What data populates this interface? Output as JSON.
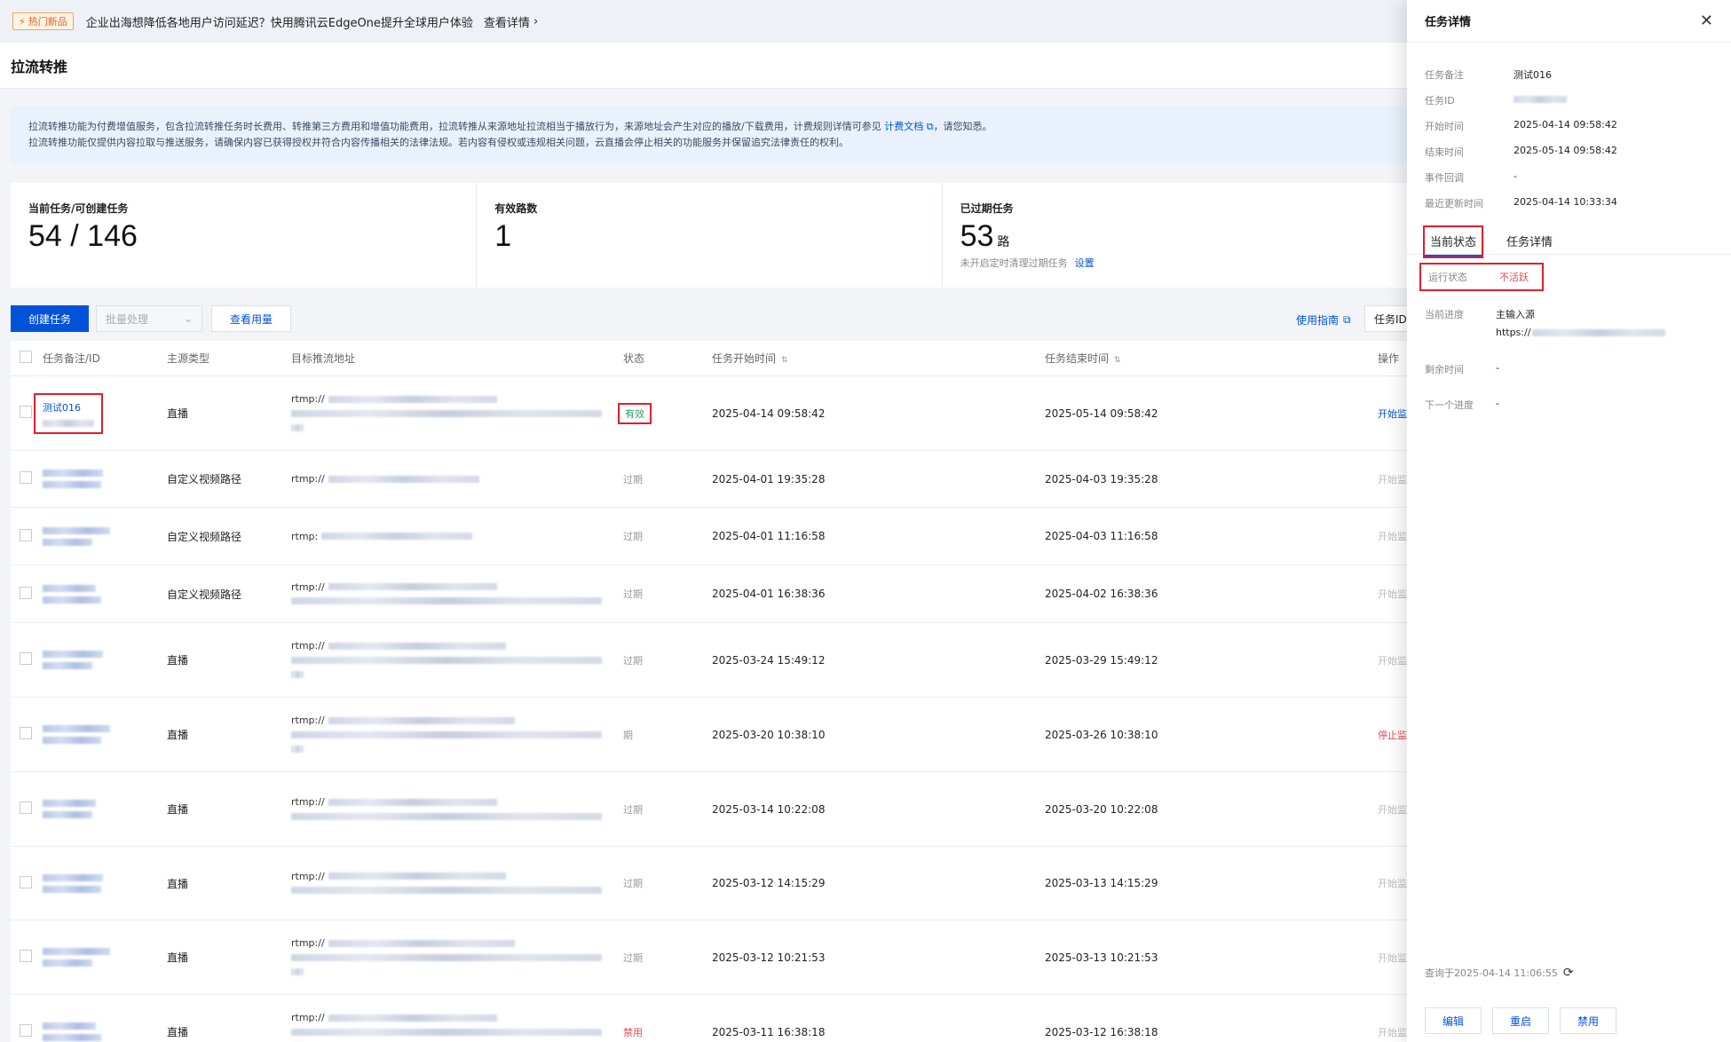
{
  "banner": {
    "tag": "热门新品",
    "text": "企业出海想降低各地用户访问延迟？快用腾讯云EdgeOne提升全球用户体验",
    "link": "查看详情"
  },
  "page": {
    "title": "拉流转推"
  },
  "notice": {
    "line1_pre": "拉流转推功能为付费增值服务，包含拉流转推任务时长费用、转推第三方费用和增值功能费用，拉流转推从来源地址拉流相当于播放行为，来源地址会产生对应的播放/下载费用，计费规则详情可参见",
    "line1_link": "计费文档",
    "line1_post": "，请您知悉。",
    "line2": "拉流转推功能仅提供内容拉取与推送服务，请确保内容已获得授权并符合内容传播相关的法律法规。若内容有侵权或违规相关问题，云直播会停止相关的功能服务并保留追究法律责任的权利。"
  },
  "stats": {
    "tasks_label": "当前任务/可创建任务",
    "tasks_value": "54 / 146",
    "active_label": "有效路数",
    "active_value": "1",
    "expired_label": "已过期任务",
    "expired_value": "53",
    "expired_unit": "路",
    "expired_sub": "未开启定时清理过期任务",
    "expired_link": "设置"
  },
  "toolbar": {
    "create": "创建任务",
    "batch": "批量处理",
    "usage": "查看用量",
    "guide": "使用指南",
    "search_prefix": "任务ID"
  },
  "table": {
    "headers": {
      "name": "任务备注/ID",
      "type": "主源类型",
      "addr": "目标推流地址",
      "status": "状态",
      "start": "任务开始时间",
      "end": "任务结束时间",
      "op": "操作"
    },
    "rows": [
      {
        "name": "测试016",
        "type": "直播",
        "addr": "rtmp://",
        "status": "有效",
        "start": "2025-04-14 09:58:42",
        "end": "2025-05-14 09:58:42",
        "op": "开始监"
      },
      {
        "name": "",
        "type": "自定义视频路径",
        "addr": "rtmp://",
        "status": "过期",
        "start": "2025-04-01 19:35:28",
        "end": "2025-04-03 19:35:28",
        "op": "开始监"
      },
      {
        "name": "",
        "type": "自定义视频路径",
        "addr": "rtmp:",
        "status": "过期",
        "start": "2025-04-01 11:16:58",
        "end": "2025-04-03 11:16:58",
        "op": "开始监"
      },
      {
        "name": "",
        "type": "自定义视频路径",
        "addr": "rtmp://",
        "status": "过期",
        "start": "2025-04-01 16:38:36",
        "end": "2025-04-02 16:38:36",
        "op": "开始监"
      },
      {
        "name": "",
        "type": "直播",
        "addr": "rtmp://",
        "status": "过期",
        "start": "2025-03-24 15:49:12",
        "end": "2025-03-29 15:49:12",
        "op": "开始监"
      },
      {
        "name": "",
        "type": "直播",
        "addr": "rtmp://",
        "status": "期",
        "start": "2025-03-20 10:38:10",
        "end": "2025-03-26 10:38:10",
        "op": "停止监"
      },
      {
        "name": "",
        "type": "直播",
        "addr": "rtmp://",
        "status": "过期",
        "start": "2025-03-14 10:22:08",
        "end": "2025-03-20 10:22:08",
        "op": "开始监"
      },
      {
        "name": "",
        "type": "直播",
        "addr": "rtmp://",
        "status": "过期",
        "start": "2025-03-12 14:15:29",
        "end": "2025-03-13 14:15:29",
        "op": "开始监"
      },
      {
        "name": "",
        "type": "直播",
        "addr": "rtmp://",
        "status": "过期",
        "start": "2025-03-12 10:21:53",
        "end": "2025-03-13 10:21:53",
        "op": "开始监"
      },
      {
        "name": "",
        "type": "直播",
        "addr": "rtmp://",
        "status": "禁用",
        "start": "2025-03-11 16:38:18",
        "end": "2025-03-12 16:38:18",
        "op": "开始监"
      }
    ]
  },
  "drawer": {
    "title": "任务详情",
    "remark_k": "任务备注",
    "remark_v": "测试016",
    "id_k": "任务ID",
    "start_k": "开始时间",
    "start_v": "2025-04-14 09:58:42",
    "end_k": "结束时间",
    "end_v": "2025-05-14 09:58:42",
    "callback_k": "事件回调",
    "callback_v": "-",
    "updated_k": "最近更新时间",
    "updated_v": "2025-04-14 10:33:34",
    "tab_status": "当前状态",
    "tab_detail": "任务详情",
    "run_k": "运行状态",
    "run_v": "不活跃",
    "progress_k": "当前进度",
    "progress_v1": "主输入源",
    "progress_v2": "https://",
    "remain_k": "剩余时间",
    "remain_v": "-",
    "next_k": "下一个进度",
    "next_v": "-",
    "query_time": "查询于2025-04-14 11:06:55",
    "btn_edit": "编辑",
    "btn_restart": "重启",
    "btn_disable": "禁用"
  },
  "colors": {
    "primary": "#0052d9",
    "valid": "#22a06b",
    "danger": "#e34d59",
    "highlight": "#e0202b"
  }
}
